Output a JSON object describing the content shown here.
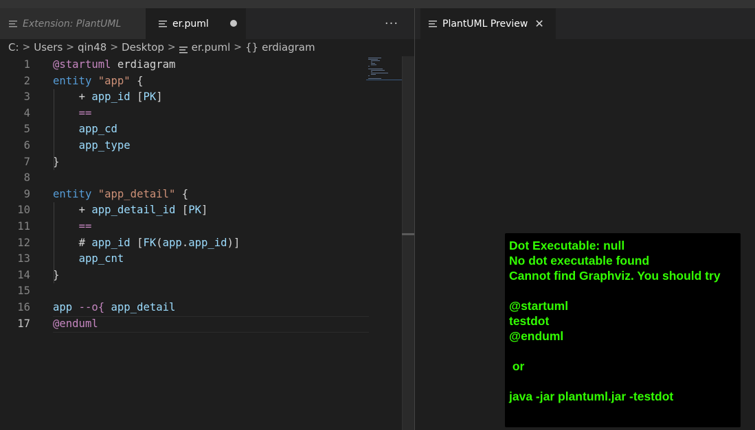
{
  "tabs": {
    "left": [
      {
        "label": "Extension: PlantUML",
        "active": false,
        "italic": true,
        "icon": "file-lines-icon"
      },
      {
        "label": "er.puml",
        "active": true,
        "dirty": true,
        "icon": "file-lines-icon"
      }
    ],
    "more_actions": "···",
    "right": [
      {
        "label": "PlantUML Preview",
        "active": true,
        "close": "✕",
        "icon": "file-lines-icon"
      }
    ]
  },
  "breadcrumb": [
    {
      "label": "C:"
    },
    {
      "label": "Users"
    },
    {
      "label": "qin48"
    },
    {
      "label": "Desktop"
    },
    {
      "label": "er.puml",
      "icon": "file-lines-icon"
    },
    {
      "label": "erdiagram",
      "icon": "braces-icon",
      "icon_glyph": "{}"
    }
  ],
  "breadcrumb_separator": ">",
  "editor": {
    "active_line": 17,
    "lines": [
      {
        "n": "1",
        "text": "@startuml erdiagram"
      },
      {
        "n": "2",
        "text": "entity \"app\" {"
      },
      {
        "n": "3",
        "text": "    + app_id [PK]"
      },
      {
        "n": "4",
        "text": "    =="
      },
      {
        "n": "5",
        "text": "    app_cd"
      },
      {
        "n": "6",
        "text": "    app_type"
      },
      {
        "n": "7",
        "text": "}"
      },
      {
        "n": "8",
        "text": ""
      },
      {
        "n": "9",
        "text": "entity \"app_detail\" {"
      },
      {
        "n": "10",
        "text": "    + app_detail_id [PK]"
      },
      {
        "n": "11",
        "text": "    =="
      },
      {
        "n": "12",
        "text": "    # app_id [FK(app.app_id)]"
      },
      {
        "n": "13",
        "text": "    app_cnt"
      },
      {
        "n": "14",
        "text": "}"
      },
      {
        "n": "15",
        "text": ""
      },
      {
        "n": "16",
        "text": "app --o{ app_detail"
      },
      {
        "n": "17",
        "text": "@enduml"
      }
    ]
  },
  "preview": {
    "error_lines": [
      "Dot Executable: null",
      "No dot executable found",
      "Cannot find Graphviz. You should try",
      "",
      "@startuml",
      "testdot",
      "@enduml",
      "",
      " or",
      "",
      "java -jar plantuml.jar -testdot"
    ]
  },
  "colors": {
    "editor_bg": "#1e1e1e",
    "tab_bar_bg": "#252526",
    "inactive_tab_bg": "#2d2d2d",
    "directive": "#c586c0",
    "keyword": "#569cd6",
    "string": "#ce9178",
    "identifier": "#9cdcfe",
    "error_text": "#33ff02",
    "error_bg": "#000000"
  }
}
